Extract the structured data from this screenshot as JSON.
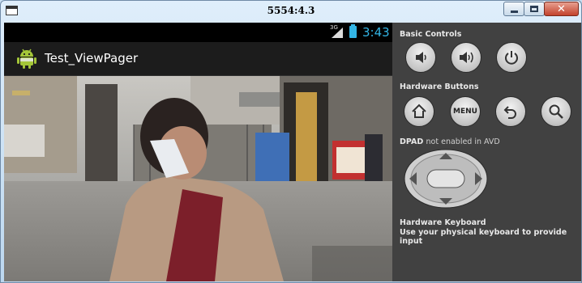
{
  "window": {
    "title": "5554:4.3",
    "controls": [
      "minimize",
      "maximize",
      "close"
    ]
  },
  "status_bar": {
    "network": "3G",
    "time": "3:43"
  },
  "app": {
    "title": "Test_ViewPager",
    "icon": "android-robot-icon"
  },
  "content": {
    "image": "photo of a crying woman seated in front of a building gate with signs"
  },
  "panel": {
    "basic_controls": {
      "label": "Basic Controls",
      "buttons": [
        "volume-down-icon",
        "volume-up-icon",
        "power-icon"
      ]
    },
    "hardware_buttons": {
      "label": "Hardware Buttons",
      "buttons": [
        "home-icon",
        "menu",
        "back-icon",
        "search-icon"
      ],
      "menu_label": "MENU"
    },
    "dpad": {
      "label_bold": "DPAD",
      "label_rest": "not enabled in AVD"
    },
    "keyboard": {
      "title": "Hardware Keyboard",
      "hint": "Use your physical keyboard to provide input"
    }
  },
  "colors": {
    "status_accent": "#33b5e5",
    "panel_bg": "#414141",
    "action_bar_bg": "#1c1c1c"
  }
}
